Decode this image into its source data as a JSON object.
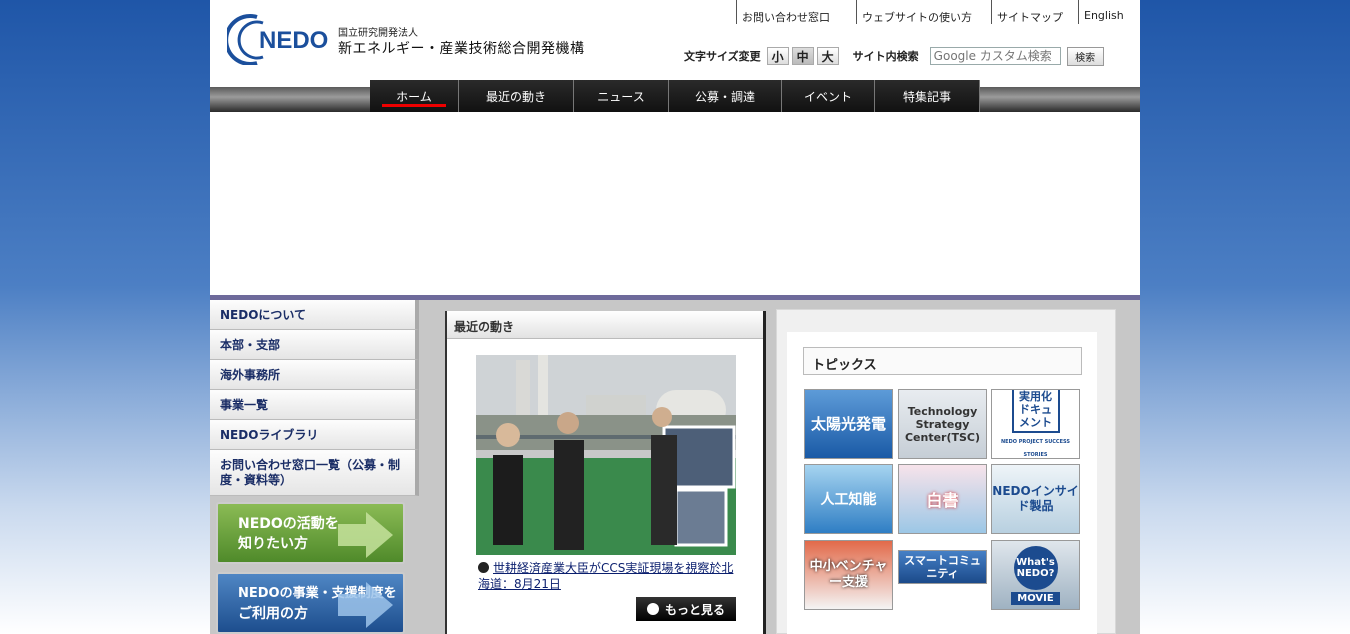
{
  "header": {
    "logo_text": "NEDO",
    "org_small": "国立研究開発法人",
    "org_name": "新エネルギー・産業技術総合開発機構"
  },
  "top_links": [
    "お問い合わせ窓口",
    "ウェブサイトの使い方",
    "サイトマップ",
    "English"
  ],
  "tools": {
    "font_size_label": "文字サイズ変更",
    "sizes": [
      "小",
      "中",
      "大"
    ],
    "site_search_label": "サイト内検索",
    "search_placeholder": "Google カスタム検索",
    "search_button": "検索"
  },
  "main_nav": [
    "ホーム",
    "最近の動き",
    "ニュース",
    "公募・調達",
    "イベント",
    "特集記事"
  ],
  "left_menu": [
    "NEDOについて",
    "本部・支部",
    "海外事務所",
    "事業一覧",
    "NEDOライブラリ",
    "お問い合わせ窓口一覧（公募・制度・資料等）"
  ],
  "banners": [
    {
      "line1": "NEDOの活動を",
      "line2": "知りたい方"
    },
    {
      "line1": "NEDOの事業・支援制度を",
      "line2": "ご利用の方"
    }
  ],
  "recent": {
    "title": "最近の動き",
    "caption": "世耕経済産業大臣がCCS実証現場を視察於北海道：8月21日",
    "more": "もっと見る"
  },
  "topics": {
    "title": "トピックス",
    "tiles": [
      {
        "text": "太陽光発電"
      },
      {
        "text": "Technology Strategy Center(TSC)"
      },
      {
        "text": "実用化ドキュメント",
        "sub": "NEDO PROJECT SUCCESS STORIES"
      },
      {
        "text": "人工知能"
      },
      {
        "text": "白書"
      },
      {
        "text": "NEDOインサイド製品"
      },
      {
        "text": "中小ベンチャー支援"
      },
      {
        "text": "スマートコミュニティ"
      },
      {
        "text": "What's NEDO?",
        "sub": "MOVIE"
      }
    ]
  },
  "colors": {
    "nav_active_underline": "#e00000",
    "menu_text": "#1a2d66",
    "accent_band": "#6e6a9b"
  }
}
